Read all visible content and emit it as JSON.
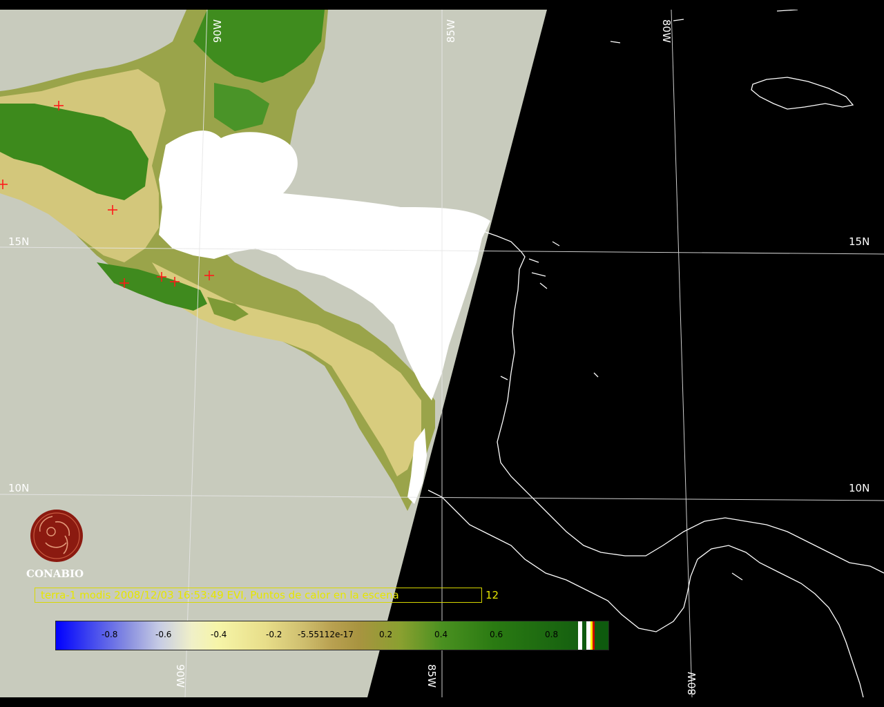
{
  "map": {
    "grid_labels": {
      "lat_15_left": "15N",
      "lat_15_right": "15N",
      "lat_10_left": "10N",
      "lat_10_right": "10N",
      "lon_90_top": "90W",
      "lon_85_top": "85W",
      "lon_80_top": "80W",
      "lon_90_bottom": "90W",
      "lon_85_bottom": "85W",
      "lon_80_bottom": "80W"
    },
    "hotspot_marker": "+",
    "hotspot_color": "#ff2020",
    "colors": {
      "swath_background": "#c8cbbd",
      "night_side": "#000000",
      "vegetation_dark": "#3f8a1c",
      "vegetation_light": "#d9cd7c",
      "cloud": "#ffffff",
      "coastline": "#ffffff"
    }
  },
  "logo": {
    "name": "CONABIO",
    "text": "CONABIO",
    "color": "#8b1a10"
  },
  "caption": {
    "text": "terra-1 modis 2008/12/03 16:53:49 EVI, Puntos de calor en la escena",
    "count": "12",
    "color": "#e6e600"
  },
  "colorbar": {
    "ticks": [
      "-0.8",
      "-0.6",
      "-0.4",
      "-0.2",
      "-5.55112e-17",
      "0.2",
      "0.4",
      "0.6",
      "0.8"
    ],
    "range": [
      -1,
      1
    ],
    "special_stripes": [
      "#ffffff",
      "#0e5a0e",
      "#ffffff",
      "#ffee00",
      "#cc0000"
    ]
  }
}
